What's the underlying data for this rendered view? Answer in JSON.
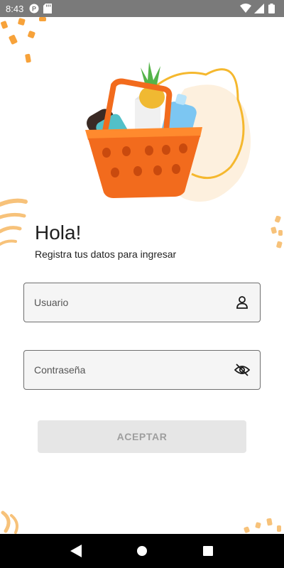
{
  "status_bar": {
    "time": "8:43",
    "left_icons": [
      "parking-app-icon",
      "sd-card-icon"
    ],
    "right_icons": [
      "wifi-icon",
      "signal-icon",
      "battery-icon"
    ]
  },
  "hero": {
    "image": "shopping-basket-illustration"
  },
  "login": {
    "greeting": "Hola!",
    "subtitle": "Registra tus datos para ingresar",
    "username_placeholder": "Usuario",
    "password_placeholder": "Contraseña",
    "accept_label": "ACEPTAR"
  },
  "nav_bar": {
    "buttons": [
      "back-icon",
      "home-icon",
      "recents-icon"
    ]
  },
  "colors": {
    "accent_orange": "#f7a23a",
    "basket_orange": "#f26b1d",
    "status_bar_bg": "#7a7a7a",
    "button_disabled_bg": "#e6e6e6",
    "button_disabled_text": "#9e9e9e"
  }
}
